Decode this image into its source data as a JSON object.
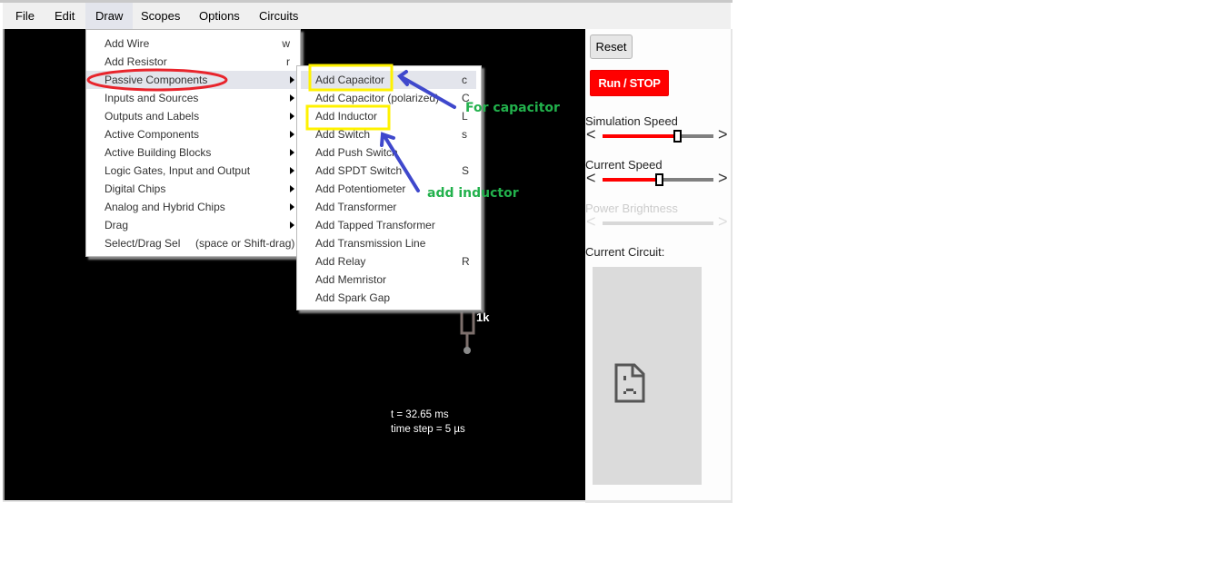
{
  "menubar": {
    "items": [
      {
        "label": "File"
      },
      {
        "label": "Edit"
      },
      {
        "label": "Draw",
        "active": true
      },
      {
        "label": "Scopes"
      },
      {
        "label": "Options"
      },
      {
        "label": "Circuits"
      }
    ]
  },
  "draw_menu": {
    "items": [
      {
        "label": "Add Wire",
        "shortcut": "w",
        "submenu": false
      },
      {
        "label": "Add Resistor",
        "shortcut": "r",
        "submenu": false
      },
      {
        "label": "Passive Components",
        "shortcut": "",
        "submenu": true,
        "highlighted": true
      },
      {
        "label": "Inputs and Sources",
        "shortcut": "",
        "submenu": true
      },
      {
        "label": "Outputs and Labels",
        "shortcut": "",
        "submenu": true
      },
      {
        "label": "Active Components",
        "shortcut": "",
        "submenu": true
      },
      {
        "label": "Active Building Blocks",
        "shortcut": "",
        "submenu": true
      },
      {
        "label": "Logic Gates, Input and Output",
        "shortcut": "",
        "submenu": true
      },
      {
        "label": "Digital Chips",
        "shortcut": "",
        "submenu": true
      },
      {
        "label": "Analog and Hybrid Chips",
        "shortcut": "",
        "submenu": true
      },
      {
        "label": "Drag",
        "shortcut": "",
        "submenu": true
      },
      {
        "label": "Select/Drag Sel",
        "shortcut": "(space or Shift-drag)",
        "submenu": false
      }
    ]
  },
  "passive_submenu": {
    "items": [
      {
        "label": "Add Capacitor",
        "shortcut": "c",
        "highlighted": true
      },
      {
        "label": "Add Capacitor (polarized)",
        "shortcut": "C"
      },
      {
        "label": "Add Inductor",
        "shortcut": "L"
      },
      {
        "label": "Add Switch",
        "shortcut": "s"
      },
      {
        "label": "Add Push Switch",
        "shortcut": ""
      },
      {
        "label": "Add SPDT Switch",
        "shortcut": "S"
      },
      {
        "label": "Add Potentiometer",
        "shortcut": ""
      },
      {
        "label": "Add Transformer",
        "shortcut": ""
      },
      {
        "label": "Add Tapped Transformer",
        "shortcut": ""
      },
      {
        "label": "Add Transmission Line",
        "shortcut": ""
      },
      {
        "label": "Add Relay",
        "shortcut": "R"
      },
      {
        "label": "Add Memristor",
        "shortcut": ""
      },
      {
        "label": "Add Spark Gap",
        "shortcut": ""
      }
    ]
  },
  "canvas": {
    "resistor_label": "1k",
    "time_text": "t = 32.65 ms",
    "timestep_text": "time step = 5 µs"
  },
  "sidebar": {
    "reset_label": "Reset",
    "run_stop_label": "Run / STOP",
    "simulation_speed": {
      "label": "Simulation Speed",
      "value_percent": 67
    },
    "current_speed": {
      "label": "Current Speed",
      "value_percent": 51
    },
    "power_brightness": {
      "label": "Power Brightness",
      "disabled": true
    },
    "current_circuit_label": "Current Circuit:",
    "preview_icon": "broken-image-icon"
  },
  "annotations": {
    "capacitor_note": "For capacitor",
    "inductor_note": "add inductor",
    "circle_color": "#e8242c",
    "box_color": "#fff200",
    "arrow_color": "#3f48cc",
    "text_color": "#22b14c"
  },
  "colors": {
    "run_button": "#ff0000",
    "slider_fill": "#ff0000",
    "menu_highlight": "#e3e5ec",
    "canvas_bg": "#000000"
  }
}
